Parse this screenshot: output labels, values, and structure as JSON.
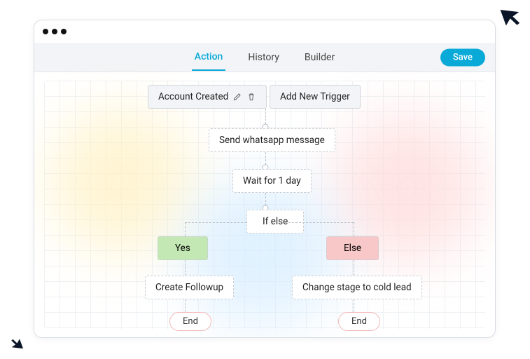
{
  "tabs": {
    "action": "Action",
    "history": "History",
    "builder": "Builder"
  },
  "save_label": "Save",
  "trigger": {
    "label": "Account Created"
  },
  "add_trigger": "Add New Trigger",
  "steps": {
    "send": "Send whatsapp message",
    "wait": "Wait for 1 day",
    "ifelse": "If else"
  },
  "branches": {
    "yes": "Yes",
    "else": "Else"
  },
  "actions": {
    "followup": "Create Followup",
    "coldlead": "Change stage to cold lead"
  },
  "end": "End"
}
